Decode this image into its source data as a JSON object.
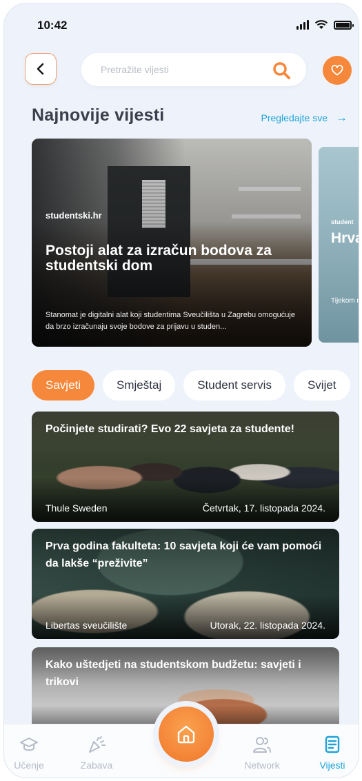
{
  "status_bar": {
    "time": "10:42"
  },
  "search": {
    "placeholder": "Pretražite vijesti"
  },
  "section": {
    "title": "Najnovije vijesti",
    "see_all": "Pregledajte sve",
    "arrow": "→"
  },
  "featured": [
    {
      "source": "studentski.hr",
      "title": "Postoji alat za izračun bodova za studentski dom",
      "description": "Stanomat je digitalni alat koji studentima Sveučilišta u Zagrebu omogućuje da brzo izračunaju svoje bodove za prijavu u studen..."
    },
    {
      "source": "student",
      "title": "Hrva sveu nast",
      "description": "Tijekom natjecat besplat"
    }
  ],
  "categories": [
    "Savjeti",
    "Smještaj",
    "Student servis",
    "Svijet"
  ],
  "articles": [
    {
      "title": "Počinjete studirati? Evo 22 savjeta za studente!",
      "source": "Thule Sweden",
      "date": "Četvrtak, 17. listopada 2024."
    },
    {
      "title": "Prva godina fakulteta: 10 savjeta koji će vam pomoći da lakše “preživite”",
      "source": "Libertas sveučilište",
      "date": "Utorak, 22. listopada 2024."
    },
    {
      "title": "Kako uštedjeti na studentskom budžetu: savjeti i trikovi",
      "source": "",
      "date": ""
    }
  ],
  "tabbar": {
    "items": [
      {
        "label": "Učenje",
        "icon": "graduation-cap-icon"
      },
      {
        "label": "Zabava",
        "icon": "party-popper-icon"
      },
      {
        "label": "",
        "icon": "home-icon"
      },
      {
        "label": "Network",
        "icon": "users-icon"
      },
      {
        "label": "Vijesti",
        "icon": "news-icon"
      }
    ]
  },
  "colors": {
    "accent": "#f5883a",
    "link": "#1ea3d8",
    "background": "#eef3fb"
  }
}
